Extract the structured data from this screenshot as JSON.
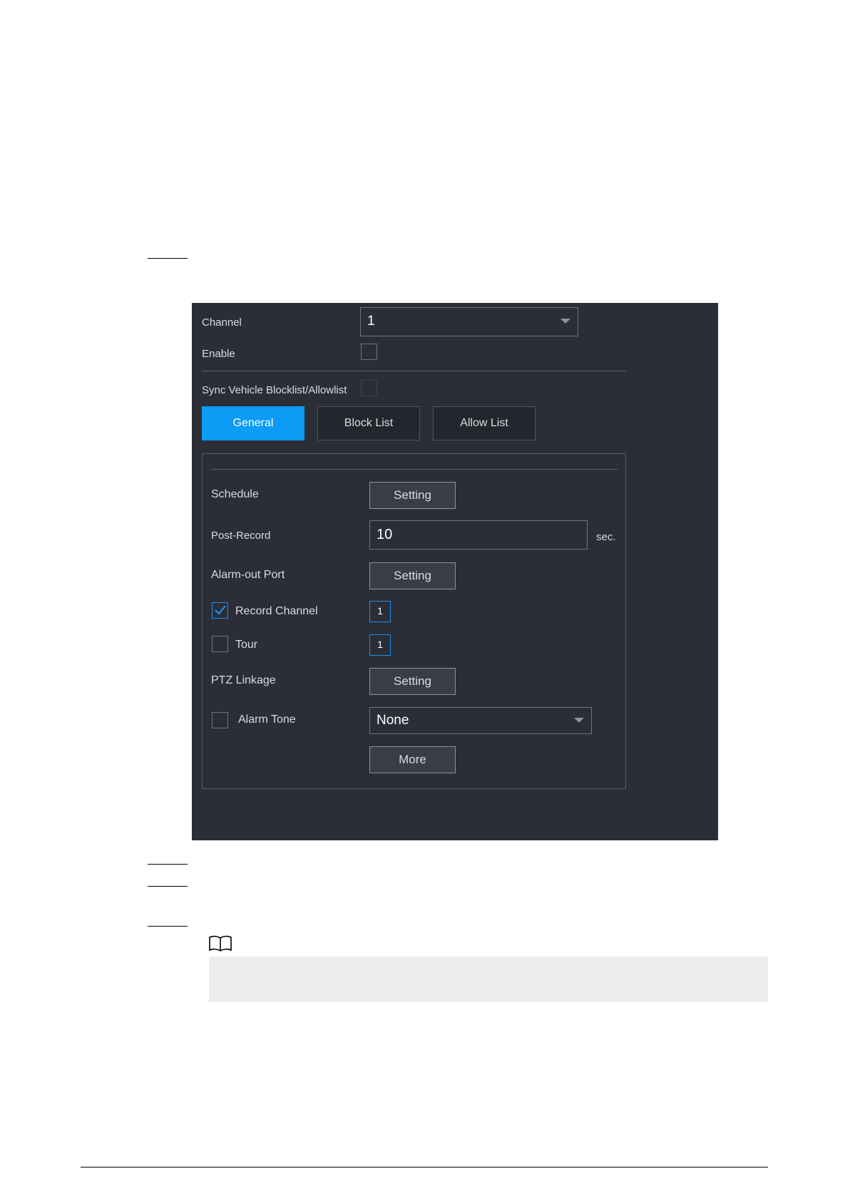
{
  "form": {
    "channel": {
      "label": "Channel",
      "value": "1"
    },
    "enable": {
      "label": "Enable",
      "checked": false
    },
    "sync": {
      "label": "Sync Vehicle Blocklist/Allowlist",
      "checked": false,
      "disabled": true
    }
  },
  "tabs": [
    {
      "label": "General",
      "active": true
    },
    {
      "label": "Block List",
      "active": false
    },
    {
      "label": "Allow List",
      "active": false
    }
  ],
  "general": {
    "schedule": {
      "label": "Schedule",
      "button": "Setting"
    },
    "post_record": {
      "label": "Post-Record",
      "value": "10",
      "unit": "sec."
    },
    "alarm_out": {
      "label": "Alarm-out Port",
      "button": "Setting"
    },
    "record_channel": {
      "label": "Record Channel",
      "checked": true,
      "channel": "1"
    },
    "tour": {
      "label": "Tour",
      "checked": false,
      "channel": "1"
    },
    "ptz": {
      "label": "PTZ Linkage",
      "button": "Setting"
    },
    "alarm_tone": {
      "label": "Alarm Tone",
      "checked": false,
      "value": "None"
    },
    "more_button": "More"
  },
  "colors": {
    "panel_bg": "#2b2e36",
    "accent": "#0c9bf5",
    "check_blue": "#1e8ef0"
  },
  "icons": {
    "note": "book-icon",
    "dropdown": "caret-down-icon",
    "check": "checkmark-icon"
  }
}
